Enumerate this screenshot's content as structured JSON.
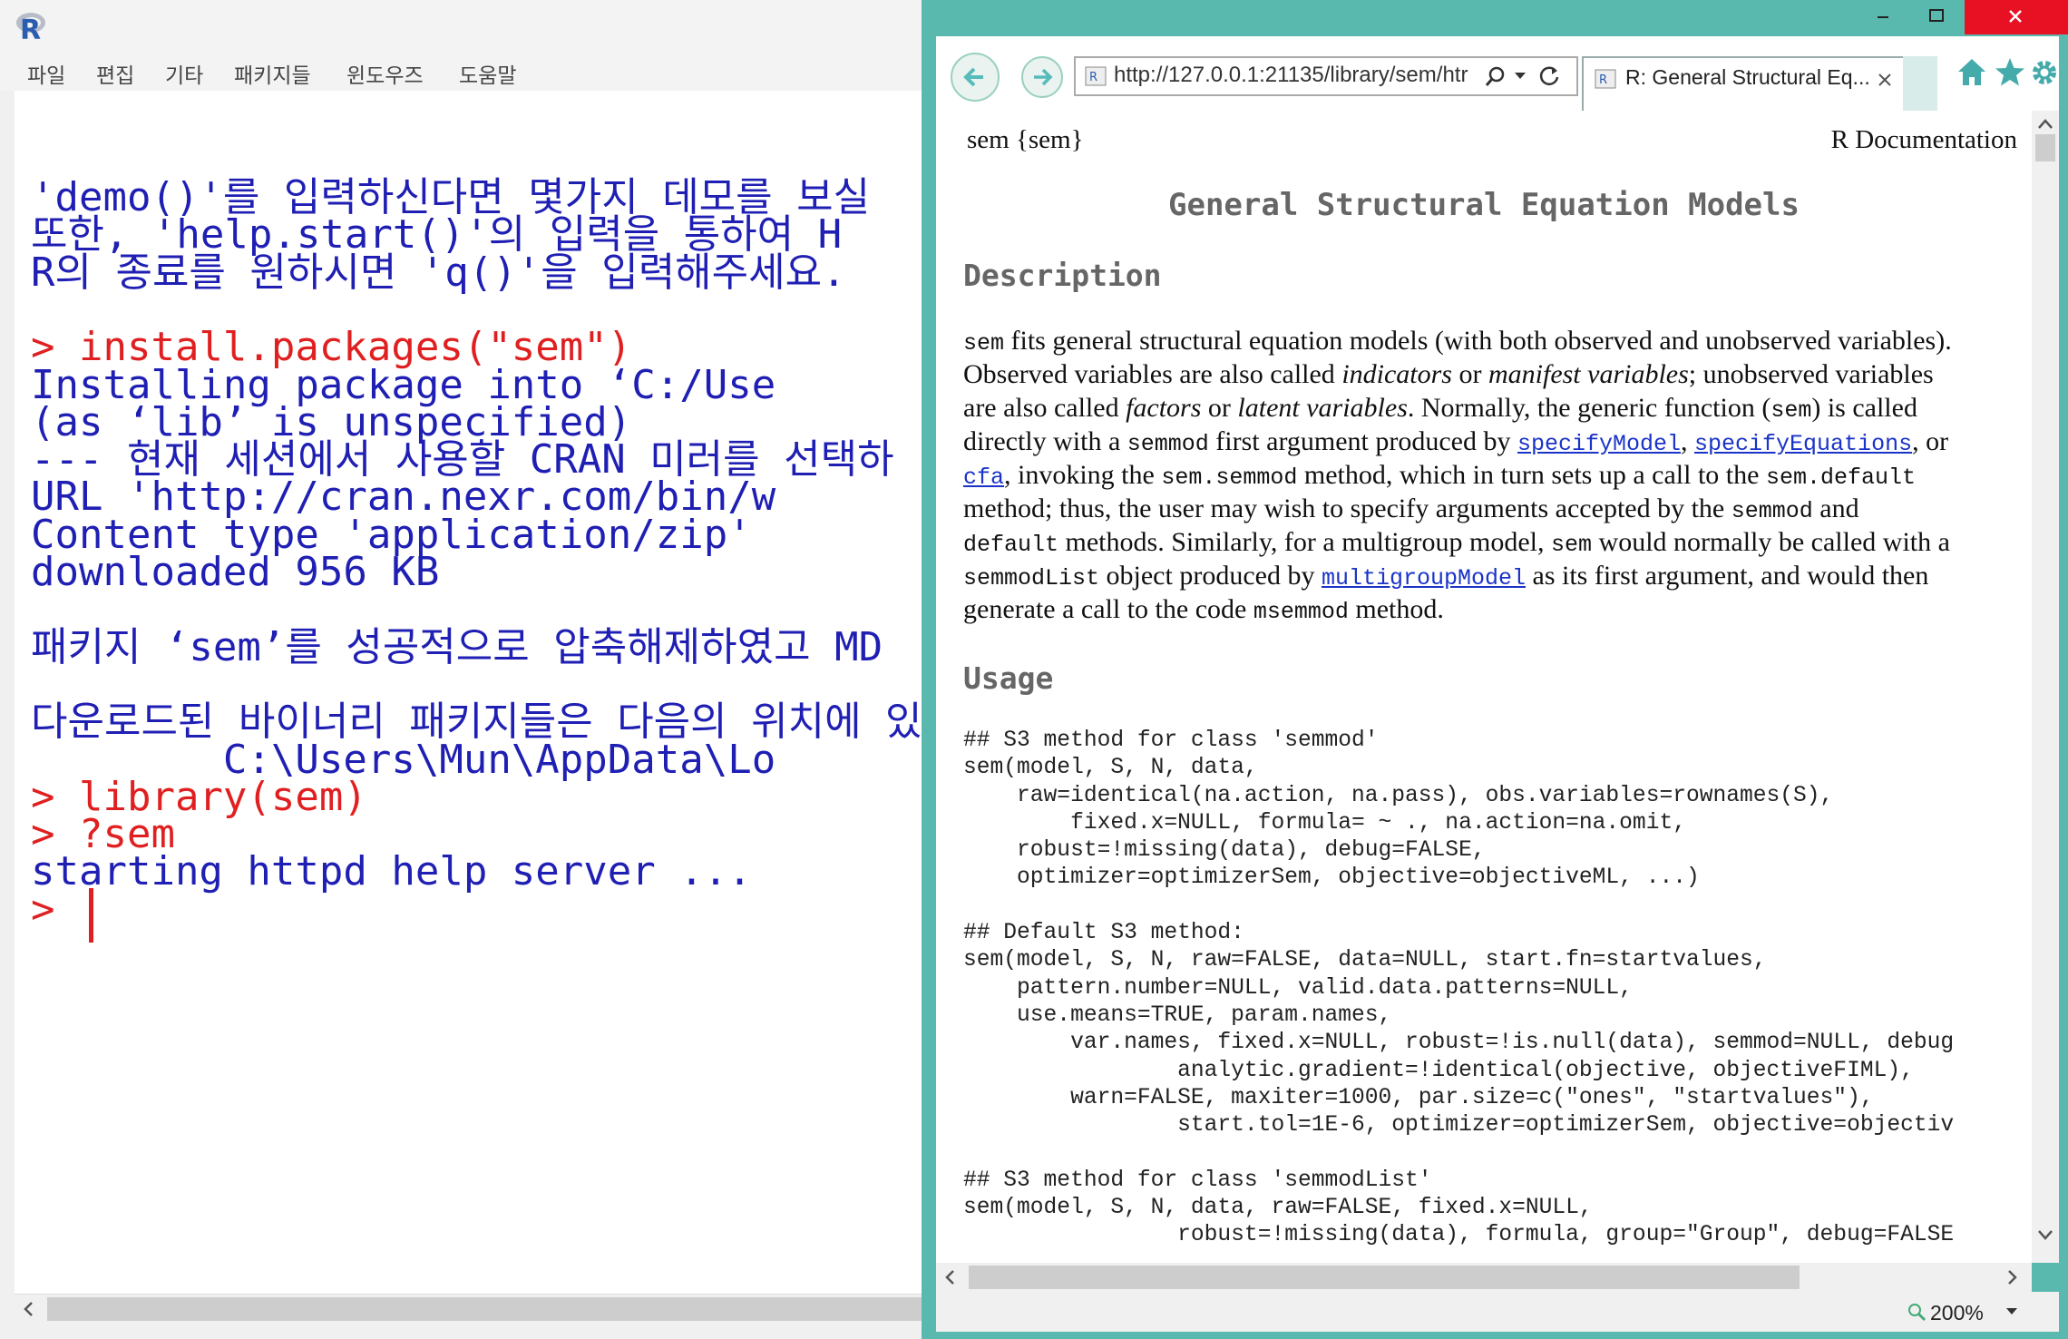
{
  "rgui": {
    "menu": [
      "파일",
      "편집",
      "기타",
      "패키지들",
      "윈도우즈",
      "도움말"
    ],
    "console_lines": [
      {
        "text": "'demo()'를 입력하신다면 몇가지 데모를 보실",
        "color": "blue"
      },
      {
        "text": "또한, 'help.start()'의 입력을 통하여 H",
        "color": "blue"
      },
      {
        "text": "R의 종료를 원하시면 'q()'을 입력해주세요.",
        "color": "blue"
      },
      {
        "text": "",
        "color": "blue"
      },
      {
        "text": "> install.packages(\"sem\")",
        "color": "red"
      },
      {
        "text": "Installing package into ‘C:/Use",
        "color": "blue"
      },
      {
        "text": "(as ‘lib’ is unspecified)",
        "color": "blue"
      },
      {
        "text": "--- 현재 세션에서 사용할 CRAN 미러를 선택하",
        "color": "blue"
      },
      {
        "text": "URL 'http://cran.nexr.com/bin/w",
        "color": "blue"
      },
      {
        "text": "Content type 'application/zip'",
        "color": "blue"
      },
      {
        "text": "downloaded 956 KB",
        "color": "blue"
      },
      {
        "text": "",
        "color": "blue"
      },
      {
        "text": "패키지 ‘sem’를 성공적으로 압축해제하였고 MD",
        "color": "blue"
      },
      {
        "text": "",
        "color": "blue"
      },
      {
        "text": "다운로드된 바이너리 패키지들은 다음의 위치에 있",
        "color": "blue"
      },
      {
        "text": "        C:\\Users\\Mun\\AppData\\Lo",
        "color": "blue"
      },
      {
        "text": "> library(sem)",
        "color": "red"
      },
      {
        "text": "> ?sem",
        "color": "red"
      },
      {
        "text": "starting httpd help server ...",
        "color": "blue"
      },
      {
        "text": "> ",
        "color": "red"
      }
    ]
  },
  "browser": {
    "address": "http://127.0.0.1:21135/library/sem/htr",
    "tab_title": "R: General Structural Eq...",
    "zoom": "200%"
  },
  "doc": {
    "topic": "sem {sem}",
    "r_documentation": "R Documentation",
    "title": "General Structural Equation Models",
    "description_heading": "Description",
    "usage_heading": "Usage",
    "description": {
      "l1_code": "sem",
      "l1_text": " fits general structural equation models (with both observed and unobserved variables).",
      "l2_a": "Observed variables are also called ",
      "l2_b": "indicators",
      "l2_c": " or ",
      "l2_d": "manifest variables",
      "l2_e": "; unobserved variables",
      "l3_a": "are also called ",
      "l3_b": "factors",
      "l3_c": " or ",
      "l3_d": "latent variables",
      "l3_e": ". Normally, the generic function (",
      "l3_code": "sem",
      "l3_f": ") is called",
      "l4_a": "directly with a ",
      "l4_code": "semmod",
      "l4_b": " first argument produced by ",
      "l4_link1": "specifyModel",
      "l4_c": ", ",
      "l4_link2": "specifyEquations",
      "l4_d": ", or",
      "l5_link": "cfa",
      "l5_a": ", invoking the ",
      "l5_code1": "sem.semmod",
      "l5_b": " method, which in turn sets up a call to the ",
      "l5_code2": "sem.default",
      "l6_a": "method; thus, the user may wish to specify arguments accepted by the ",
      "l6_code": "semmod",
      "l6_b": " and",
      "l7_code1": "default",
      "l7_a": " methods. Similarly, for a multigroup model, ",
      "l7_code2": "sem",
      "l7_b": " would normally be called with a",
      "l8_code": "semmodList",
      "l8_a": " object produced by ",
      "l8_link": "multigroupModel",
      "l8_b": " as its first argument, and would then",
      "l9_a": "generate a call to the code ",
      "l9_code": "msemmod",
      "l9_b": " method."
    },
    "usage_code": "## S3 method for class 'semmod'\nsem(model, S, N, data,\n    raw=identical(na.action, na.pass), obs.variables=rownames(S),\n        fixed.x=NULL, formula= ~ ., na.action=na.omit,\n    robust=!missing(data), debug=FALSE,\n    optimizer=optimizerSem, objective=objectiveML, ...)\n\n## Default S3 method:\nsem(model, S, N, raw=FALSE, data=NULL, start.fn=startvalues,\n    pattern.number=NULL, valid.data.patterns=NULL,\n    use.means=TRUE, param.names,\n        var.names, fixed.x=NULL, robust=!is.null(data), semmod=NULL, debug\n                analytic.gradient=!identical(objective, objectiveFIML),\n        warn=FALSE, maxiter=1000, par.size=c(\"ones\", \"startvalues\"),\n                start.tol=1E-6, optimizer=optimizerSem, objective=objectiv\n\n## S3 method for class 'semmodList'\nsem(model, S, N, data, raw=FALSE, fixed.x=NULL,\n                robust=!missing(data), formula, group=\"Group\", debug=FALSE"
  }
}
